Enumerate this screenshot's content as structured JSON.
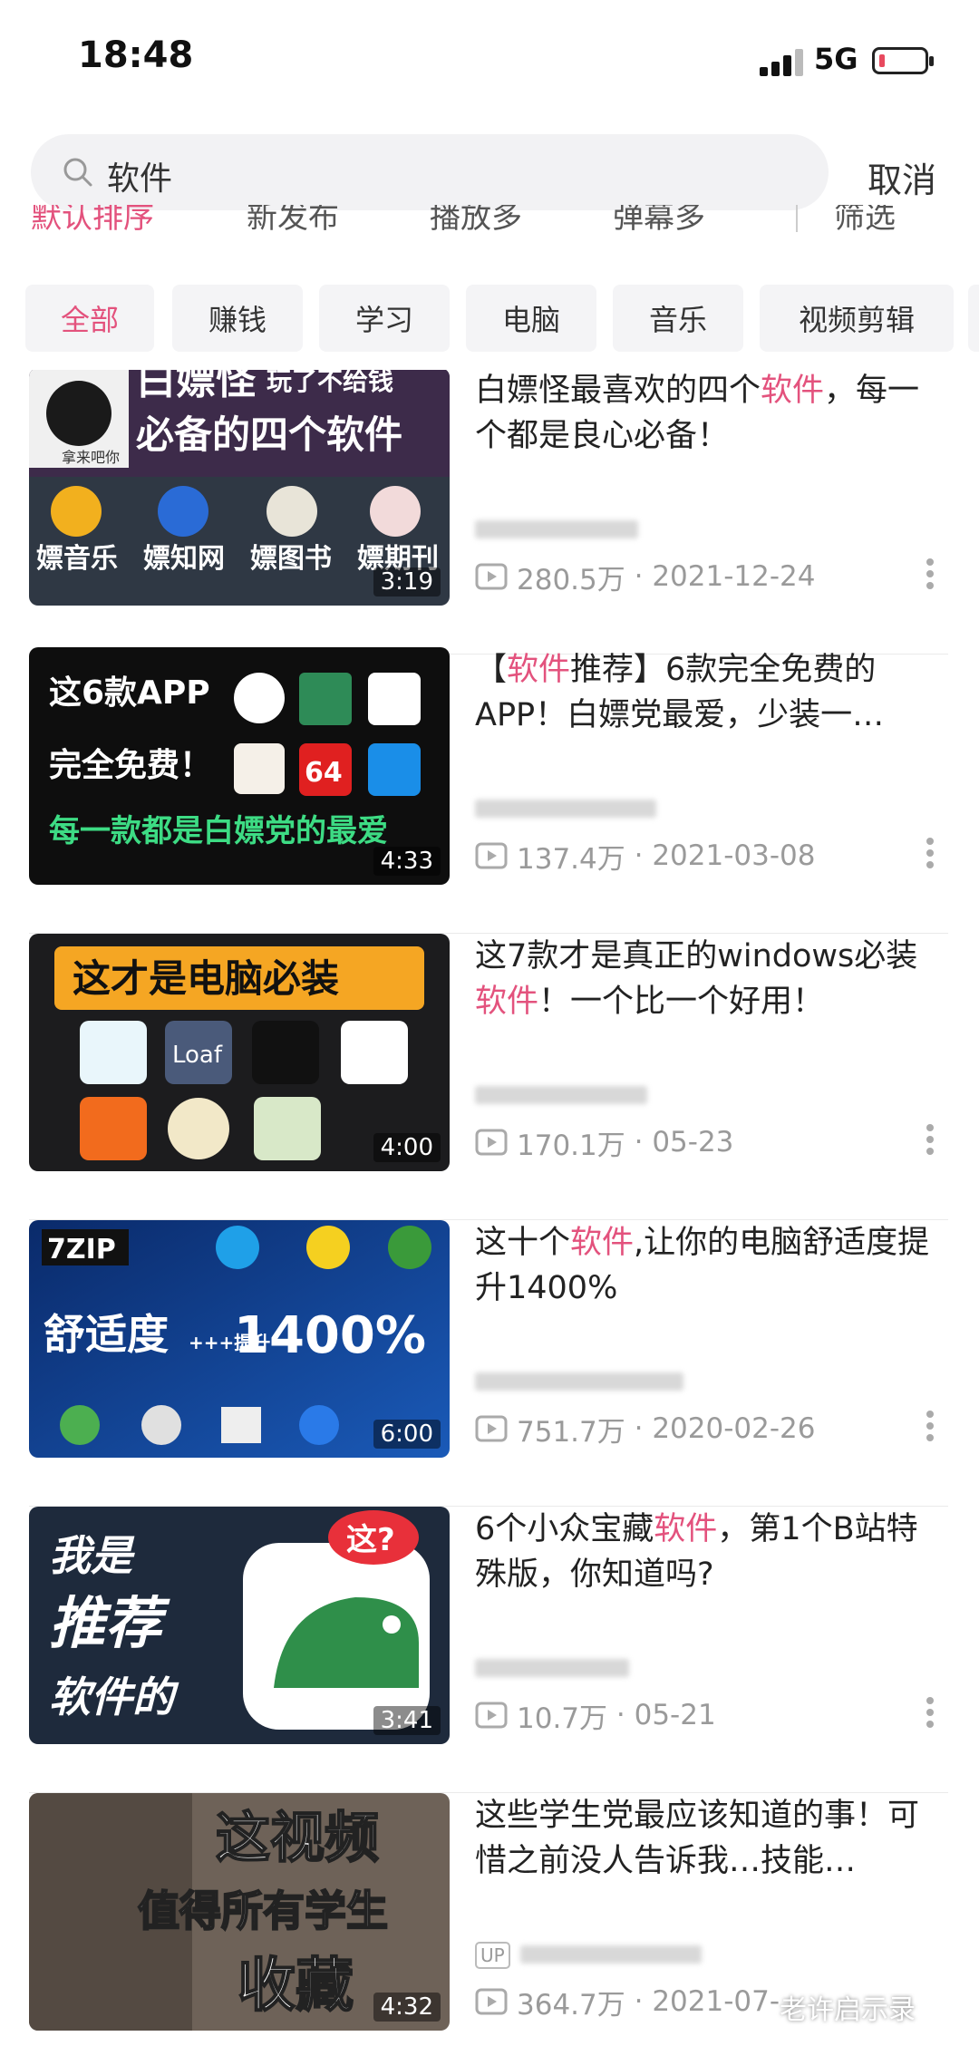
{
  "status_bar": {
    "time": "18:48",
    "network": "5G"
  },
  "search": {
    "query": "软件",
    "cancel_label": "取消"
  },
  "sort_options": [
    "默认排序",
    "新发布",
    "播放多",
    "弹幕多",
    "筛选"
  ],
  "categories": [
    "全部",
    "赚钱",
    "学习",
    "电脑",
    "音乐",
    "视频剪辑"
  ],
  "videos": [
    {
      "title_pre": "白嫖怪最喜欢的四个",
      "title_hl": "软件",
      "title_post": "，每一个都是良心必备！",
      "views": "280.5万",
      "date": "2021-12-24",
      "duration": "3:19",
      "thumb_lines": [
        "白嫖怪",
        "玩了不给钱",
        "必备的四个软件"
      ],
      "thumb_apps": [
        "嫖音乐",
        "嫖知网",
        "嫖图书",
        "嫖期刊"
      ]
    },
    {
      "title_pre": "【",
      "title_hl": "软件",
      "title_post": "推荐】6款完全免费的APP！白嫖党最爱，少装一…",
      "views": "137.4万",
      "date": "2021-03-08",
      "duration": "4:33",
      "thumb_lines": [
        "这6款APP",
        "完全免费！",
        "每一款都是白嫖党的最爱"
      ]
    },
    {
      "title_pre": "这7款才是真正的windows必装",
      "title_hl": "软件",
      "title_post": "！一个比一个好用！",
      "views": "170.1万",
      "date": "05-23",
      "duration": "4:00",
      "thumb_lines": [
        "这才是电脑必装",
        "Loaf"
      ]
    },
    {
      "title_pre": "这十个",
      "title_hl": "软件",
      "title_post": ",让你的电脑舒适度提升1400%",
      "views": "751.7万",
      "date": "2020-02-26",
      "duration": "6:00",
      "thumb_lines": [
        "7ZIP",
        "舒适度",
        "+++提升",
        "1400%"
      ]
    },
    {
      "title_pre": "6个小众宝藏",
      "title_hl": "软件",
      "title_post": "，第1个B站特殊版，你知道吗?",
      "views": "10.7万",
      "date": "05-21",
      "duration": "3:41",
      "thumb_lines": [
        "我是",
        "推荐",
        "软件的",
        "这?"
      ]
    },
    {
      "title_pre": "这些学生党最应该知道的事！可惜之前没人告诉我…技能…",
      "title_hl": "",
      "title_post": "",
      "views": "364.7万",
      "date": "2021-07-",
      "duration": "4:32",
      "thumb_lines": [
        "这视频",
        "值得所有学生",
        "收藏"
      ],
      "uploader_badge": "UP"
    }
  ],
  "watermark": "老许启示录",
  "colors": {
    "accent": "#e3527d",
    "meta_gray": "#9a9a9a"
  },
  "icons": [
    "search-icon",
    "play-count-icon",
    "more-icon",
    "signal-icon",
    "battery-icon"
  ]
}
